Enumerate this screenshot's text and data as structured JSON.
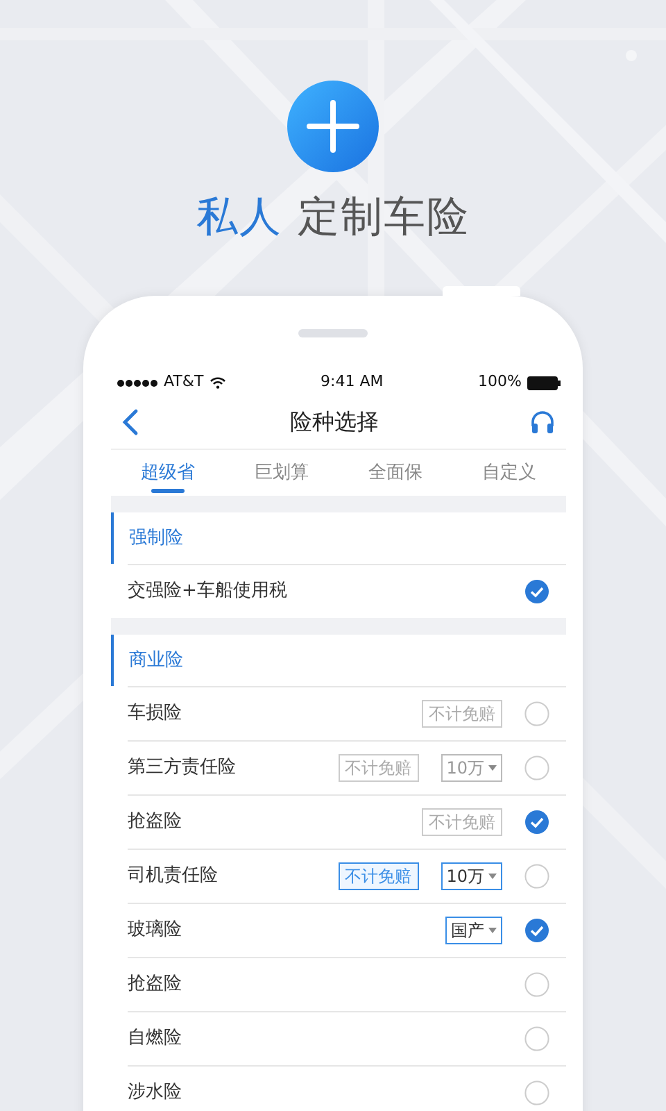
{
  "hero": {
    "title_highlight": "私人",
    "title_rest": "定制车险"
  },
  "status_bar": {
    "carrier": "AT&T",
    "time": "9:41 AM",
    "battery": "100%"
  },
  "nav": {
    "title": "险种选择"
  },
  "tabs": [
    {
      "label": "超级省",
      "selected": true
    },
    {
      "label": "巨划算",
      "selected": false
    },
    {
      "label": "全面保",
      "selected": false
    },
    {
      "label": "自定义",
      "selected": false
    }
  ],
  "sections": [
    {
      "title": "强制险",
      "items": [
        {
          "name": "交强险+车船使用税",
          "checked": true
        }
      ]
    },
    {
      "title": "商业险",
      "items": [
        {
          "name": "车损险",
          "waiver": {
            "label": "不计免赔",
            "selected": false
          },
          "checked": false
        },
        {
          "name": "第三方责任险",
          "waiver": {
            "label": "不计免赔",
            "selected": false
          },
          "amount": {
            "value": "10万",
            "selected": false
          },
          "checked": false
        },
        {
          "name": "抢盗险",
          "waiver": {
            "label": "不计免赔",
            "selected": false
          },
          "checked": true
        },
        {
          "name": "司机责任险",
          "waiver": {
            "label": "不计免赔",
            "selected": true
          },
          "amount": {
            "value": "10万",
            "selected": true
          },
          "checked": false
        },
        {
          "name": "玻璃险",
          "amount": {
            "value": "国产",
            "selected": true
          },
          "checked": true
        },
        {
          "name": "抢盗险",
          "checked": false
        },
        {
          "name": "自燃险",
          "checked": false
        },
        {
          "name": "涉水险",
          "checked": false
        }
      ]
    }
  ]
}
